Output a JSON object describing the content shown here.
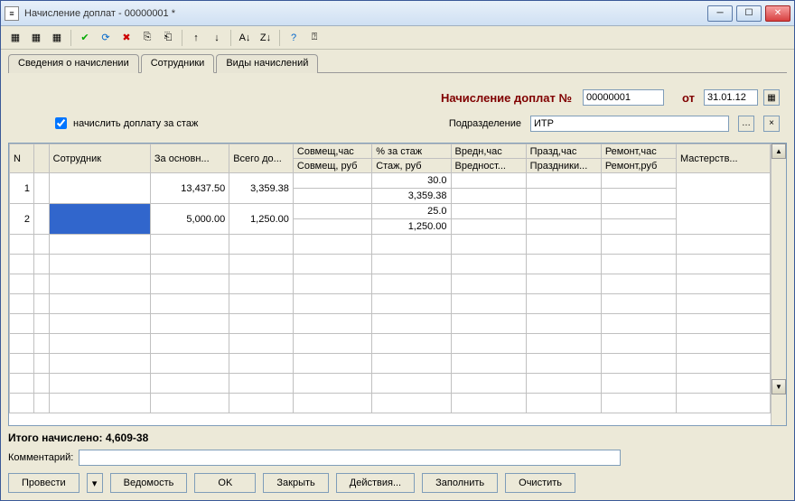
{
  "window": {
    "title": "Начисление доплат - 00000001 *"
  },
  "tabs": {
    "t0": "Сведения о начислении",
    "t1": "Сотрудники",
    "t2": "Виды начислений"
  },
  "form": {
    "main_label": "Начисление доплат №",
    "doc_number": "00000001",
    "from_label": "от",
    "date": "31.01.12",
    "checkbox_label": "начислить доплату за стаж",
    "checkbox_checked": true,
    "dept_label": "Подразделение",
    "dept_value": "ИТР"
  },
  "grid": {
    "headers": {
      "n": "N",
      "emp": "Сотрудник",
      "base": "За основн...",
      "total": "Всего до...",
      "sov1": "Совмещ,час",
      "sov2": "Совмещ, руб",
      "pct1": "% за стаж",
      "pct2": "Стаж, руб",
      "vred1": "Вредн,час",
      "vred2": "Вредност...",
      "praz1": "Празд,час",
      "praz2": "Праздники...",
      "rem1": "Ремонт,час",
      "rem2": "Ремонт,руб",
      "mas": "Мастерств..."
    },
    "rows": [
      {
        "n": "1",
        "emp": "",
        "base": "13,437.50",
        "total": "3,359.38",
        "pct": "30.0",
        "stazh_rub": "3,359.38"
      },
      {
        "n": "2",
        "emp": "",
        "selected": true,
        "base": "5,000.00",
        "total": "1,250.00",
        "pct": "25.0",
        "stazh_rub": "1,250.00"
      }
    ]
  },
  "totals": {
    "label": "Итого начислено:",
    "value": "4,609-38"
  },
  "comment": {
    "label": "Комментарий:",
    "value": ""
  },
  "buttons": {
    "provesti": "Провести",
    "vedomost": "Ведомость",
    "ok": "OK",
    "close": "Закрыть",
    "actions": "Действия...",
    "fill": "Заполнить",
    "clear": "Очистить"
  }
}
